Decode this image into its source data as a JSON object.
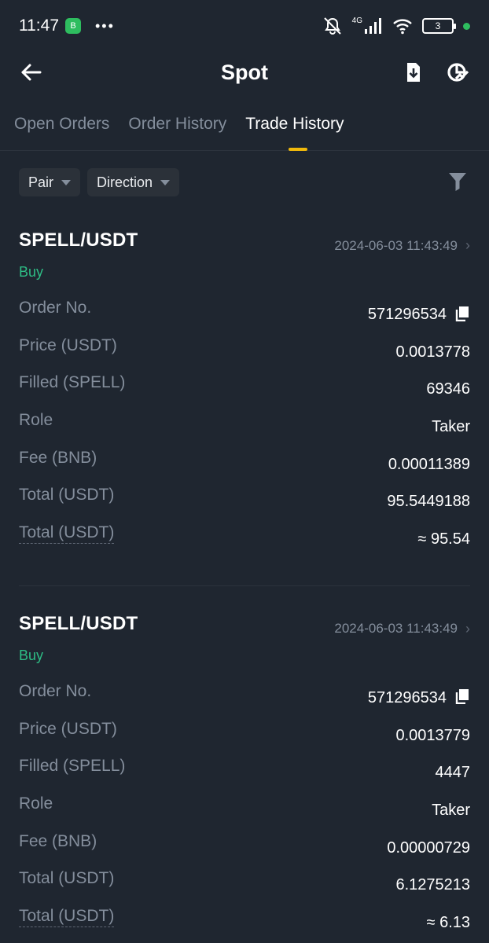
{
  "status_bar": {
    "time": "11:47",
    "app_badge": "B",
    "more": "•••",
    "network": "4G",
    "battery": "3",
    "icons": [
      "mute-icon",
      "signal-icon",
      "wifi-icon",
      "battery-icon"
    ]
  },
  "header": {
    "title": "Spot",
    "back_icon": "arrow-left-icon",
    "actions": [
      "download-icon",
      "pnl-analysis-icon"
    ]
  },
  "tabs": [
    {
      "label": "Open Orders",
      "active": false
    },
    {
      "label": "Order History",
      "active": false
    },
    {
      "label": "Trade History",
      "active": true
    }
  ],
  "filters": {
    "pair": "Pair",
    "direction": "Direction",
    "filter_icon": "funnel-icon"
  },
  "trades": [
    {
      "pair": "SPELL/USDT",
      "datetime": "2024-06-03 11:43:49",
      "side": "Buy",
      "rows": [
        {
          "label": "Order No.",
          "value": "571296534"
        },
        {
          "label": "Price (USDT)",
          "value": "0.0013778"
        },
        {
          "label": "Filled (SPELL)",
          "value": "69346"
        },
        {
          "label": "Role",
          "value": "Taker"
        },
        {
          "label": "Fee (BNB)",
          "value": "0.00011389"
        },
        {
          "label": "Total (USDT)",
          "value": "95.5449188"
        },
        {
          "label": "Total (USDT)",
          "value": "≈ 95.54"
        }
      ]
    },
    {
      "pair": "SPELL/USDT",
      "datetime": "2024-06-03 11:43:49",
      "side": "Buy",
      "rows": [
        {
          "label": "Order No.",
          "value": "571296534"
        },
        {
          "label": "Price (USDT)",
          "value": "0.0013779"
        },
        {
          "label": "Filled (SPELL)",
          "value": "4447"
        },
        {
          "label": "Role",
          "value": "Taker"
        },
        {
          "label": "Fee (BNB)",
          "value": "0.00000729"
        },
        {
          "label": "Total (USDT)",
          "value": "6.1275213"
        },
        {
          "label": "Total (USDT)",
          "value": "≈ 6.13"
        }
      ]
    }
  ],
  "colors": {
    "background": "#1f2630",
    "accent": "#f0b90b",
    "buy": "#2ebd85",
    "muted": "#848e9c"
  }
}
